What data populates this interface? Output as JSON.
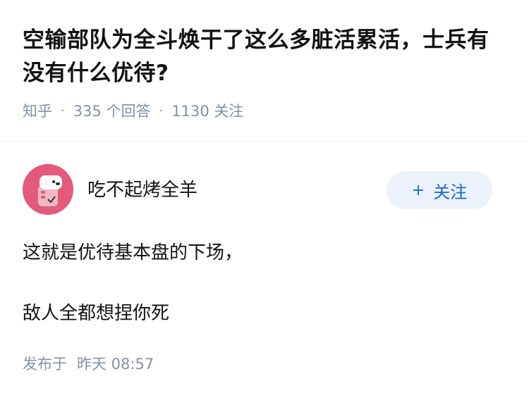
{
  "question": {
    "title": "空输部队为全斗焕干了这么多脏活累活，士兵有没有什么优待?",
    "source": "知乎",
    "answer_count": "335 个回答",
    "follower_count": "1130 关注"
  },
  "answer": {
    "author_name": "吃不起烤全羊",
    "follow_label": "关注",
    "follow_icon": "plus-icon",
    "paragraphs": [
      "这就是优待基本盘的下场，",
      "敌人全都想捏你死"
    ],
    "published_label": "发布于",
    "published_time": "昨天 08:57"
  },
  "colors": {
    "follow_text": "#1767d4",
    "follow_background": "#ebf2fb",
    "meta_text": "#8590a6",
    "avatar_background": "#e35a7c"
  }
}
